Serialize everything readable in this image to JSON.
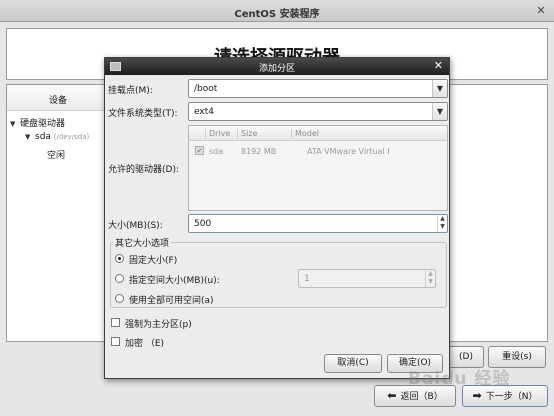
{
  "outer_window": {
    "title": "CentOS 安装程序",
    "close_glyph": "✕",
    "header_title": "请选择源驱动器",
    "list_header": "设备",
    "tree": [
      {
        "label": "硬盘驱动器",
        "arrow": "▼"
      },
      {
        "label": "sda",
        "sub": "(/dev/sda)",
        "arrow": "▼"
      },
      {
        "label": "空闲"
      }
    ],
    "buttons": {
      "partial": "(D)",
      "reset": "重设(s)",
      "back": "返回（B）",
      "next": "下一步（N）"
    }
  },
  "dialog": {
    "title": "添加分区",
    "close_glyph": "✕",
    "mount_point": {
      "label": "挂载点(M):",
      "value": "/boot"
    },
    "fs_type": {
      "label": "文件系统类型(T):",
      "value": "ext4"
    },
    "drives": {
      "label": "允许的驱动器(D):",
      "columns": [
        "Drive",
        "Size",
        "Model"
      ],
      "rows": [
        {
          "checked": true,
          "drive": "sda",
          "size": "8192 MB",
          "model": "ATA VMware Virtual I"
        }
      ]
    },
    "size": {
      "label": "大小(MB)(S):",
      "value": "500"
    },
    "other_options": {
      "title": "其它大小选项",
      "options": [
        {
          "label": "固定大小(F)",
          "selected": true
        },
        {
          "label": "指定空间大小(MB)(u):",
          "selected": false
        },
        {
          "label": "使用全部可用空间(a)",
          "selected": false
        }
      ],
      "max_size_value": "1"
    },
    "force_primary": {
      "label": "强制为主分区(p)",
      "checked": false
    },
    "encrypt": {
      "label": "加密 （E)",
      "checked": false
    },
    "buttons": {
      "cancel": "取消(C)",
      "ok": "确定(O)"
    }
  },
  "watermark": "Baidu 经验",
  "colors": {
    "dialog_titlebar": "#2a2a2a",
    "window_bg": "#e6e6e6"
  }
}
